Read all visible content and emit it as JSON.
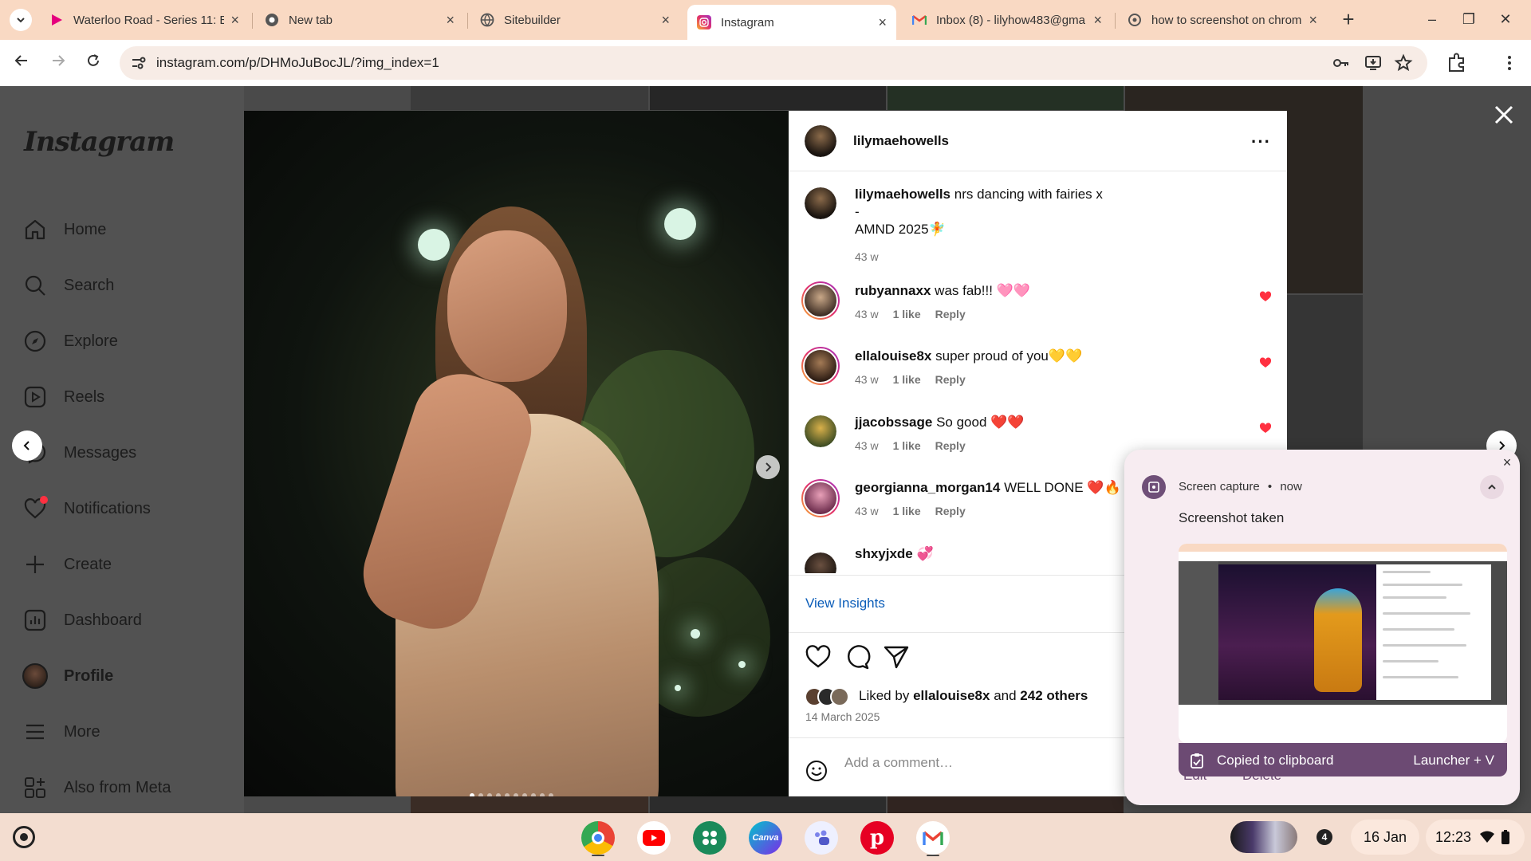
{
  "browser": {
    "tabs": [
      {
        "title": "Waterloo Road - Series 11: E",
        "icon": "bbc-iplayer-icon"
      },
      {
        "title": "New tab",
        "icon": "chrome-icon"
      },
      {
        "title": "Sitebuilder",
        "icon": "globe-icon"
      },
      {
        "title": "Instagram",
        "icon": "instagram-icon",
        "active": true
      },
      {
        "title": "Inbox (8) - lilyhow483@gma",
        "icon": "gmail-icon"
      },
      {
        "title": "how to screenshot on chrome",
        "icon": "google-icon"
      }
    ],
    "url": "instagram.com/p/DHMoJuBocJL/?img_index=1"
  },
  "instagram": {
    "logo": "Instagram",
    "nav": [
      {
        "label": "Home",
        "icon": "home-icon"
      },
      {
        "label": "Search",
        "icon": "search-icon"
      },
      {
        "label": "Explore",
        "icon": "compass-icon"
      },
      {
        "label": "Reels",
        "icon": "reels-icon"
      },
      {
        "label": "Messages",
        "icon": "messenger-icon"
      },
      {
        "label": "Notifications",
        "icon": "heart-icon"
      },
      {
        "label": "Create",
        "icon": "plus-icon"
      },
      {
        "label": "Dashboard",
        "icon": "dashboard-icon"
      },
      {
        "label": "Profile",
        "icon": "profile-avatar"
      },
      {
        "label": "More",
        "icon": "menu-icon"
      },
      {
        "label": "Also from Meta",
        "icon": "meta-icon"
      }
    ]
  },
  "post": {
    "author": "lilymaehowells",
    "caption_user": "lilymaehowells",
    "caption_line1": "nrs dancing with fairies x",
    "caption_line2": "-",
    "caption_line3": "AMND 2025🧚",
    "caption_time": "43 w",
    "comments": [
      {
        "user": "rubyannaxx",
        "text": "was fab!!! 🩷🩷",
        "time": "43 w",
        "likes": "1 like",
        "reply": "Reply"
      },
      {
        "user": "ellalouise8x",
        "text": "super proud of you💛💛",
        "time": "43 w",
        "likes": "1 like",
        "reply": "Reply"
      },
      {
        "user": "jjacobssage",
        "text": "So good ❤️❤️",
        "time": "43 w",
        "likes": "1 like",
        "reply": "Reply"
      },
      {
        "user": "georgianna_morgan14",
        "text": "WELL DONE ❤️🔥",
        "time": "43 w",
        "likes": "1 like",
        "reply": "Reply"
      },
      {
        "user": "shxyjxde",
        "text": "💞"
      }
    ],
    "view_insights": "View Insights",
    "liked_prefix": "Liked by",
    "liked_user": "ellalouise8x",
    "liked_and": "and",
    "liked_others": "242 others",
    "date": "14 March 2025",
    "add_comment_placeholder": "Add a comment…"
  },
  "notification": {
    "app": "Screen capture",
    "dot": "•",
    "time": "now",
    "title": "Screenshot taken",
    "copied": "Copied to clipboard",
    "shortcut": "Launcher + V",
    "edit": "Edit",
    "delete": "Delete"
  },
  "shelf": {
    "apps": [
      {
        "name": "Chrome",
        "color": "#4285f4"
      },
      {
        "name": "YouTube",
        "color": "#ff0000"
      },
      {
        "name": "Slack",
        "color": "#2bac76"
      },
      {
        "name": "Canva",
        "color": "#00c4cc",
        "label": "Canva"
      },
      {
        "name": "Teams",
        "color": "#7b83eb"
      },
      {
        "name": "Pinterest",
        "color": "#e60023"
      },
      {
        "name": "Gmail",
        "color": "#ffffff"
      }
    ],
    "notification_count": "4",
    "date": "16 Jan",
    "time": "12:23"
  }
}
